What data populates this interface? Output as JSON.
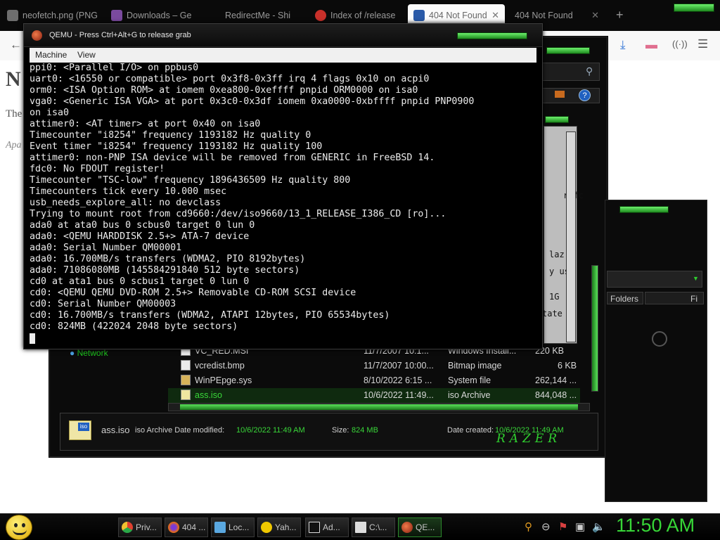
{
  "browser": {
    "tabs": [
      {
        "label": "neofetch.png (PNG I",
        "favicon_color": "#6e6e6e"
      },
      {
        "label": "Downloads – Ge",
        "favicon_color": "#7a4a9e"
      },
      {
        "label": "RedirectMe - Shi",
        "favicon_color": "#3a3a3a"
      },
      {
        "label": "Index of /release",
        "favicon_color": "#c8302a"
      },
      {
        "label": "404 Not Found",
        "favicon_color": "#2a5aa8",
        "active": true
      },
      {
        "label": "404 Not Found",
        "favicon_color": "#000000"
      }
    ],
    "new_tab_icon": "plus-icon",
    "page_fragments": [
      "N",
      "The",
      "Apa"
    ]
  },
  "qemu": {
    "title": "QEMU - Press Ctrl+Alt+G to release grab",
    "menu": [
      "Machine",
      "View"
    ],
    "console_lines": [
      "ppi0: <Parallel I/O> on ppbus0",
      "uart0: <16550 or compatible> port 0x3f8-0x3ff irq 4 flags 0x10 on acpi0",
      "orm0: <ISA Option ROM> at iomem 0xea800-0xeffff pnpid ORM0000 on isa0",
      "vga0: <Generic ISA VGA> at port 0x3c0-0x3df iomem 0xa0000-0xbffff pnpid PNP0900",
      "on isa0",
      "attimer0: <AT timer> at port 0x40 on isa0",
      "Timecounter \"i8254\" frequency 1193182 Hz quality 0",
      "Event timer \"i8254\" frequency 1193182 Hz quality 100",
      "attimer0: non-PNP ISA device will be removed from GENERIC in FreeBSD 14.",
      "fdc0: No FDOUT register!",
      "Timecounter \"TSC-low\" frequency 1896436509 Hz quality 800",
      "Timecounters tick every 10.000 msec",
      "usb_needs_explore_all: no devclass",
      "Trying to mount root from cd9660:/dev/iso9660/13_1_RELEASE_I386_CD [ro]...",
      "ada0 at ata0 bus 0 scbus0 target 0 lun 0",
      "ada0: <QEMU HARDDISK 2.5+> ATA-7 device",
      "ada0: Serial Number QM00001",
      "ada0: 16.700MB/s transfers (WDMA2, PIO 8192bytes)",
      "ada0: 71086080MB (145584291840 512 byte sectors)",
      "cd0 at ata1 bus 0 scbus1 target 0 lun 0",
      "cd0: <QEMU QEMU DVD-ROM 2.5+> Removable CD-ROM SCSI device",
      "cd0: Serial Number QM00003",
      "cd0: 16.700MB/s transfers (WDMA2, ATAPI 12bytes, PIO 65534bytes)",
      "cd0: 824MB (422024 2048 byte sectors)"
    ]
  },
  "explorer": {
    "sidebar_item": "Network",
    "column_folders": "Folders",
    "column_fi": "Fi",
    "partial_right_text": [
      "refc",
      "laz",
      "y us",
      "1G",
      "tate"
    ],
    "files": [
      {
        "name": "VC_RED.MSI",
        "date": "11/7/2007 10:1...",
        "type": "Windows Install...",
        "size": "220 KB"
      },
      {
        "name": "vcredist.bmp",
        "date": "11/7/2007 10:00...",
        "type": "Bitmap image",
        "size": "6 KB"
      },
      {
        "name": "WinPEpge.sys",
        "date": "8/10/2022 6:15 ...",
        "type": "System file",
        "size": "262,144 ..."
      },
      {
        "name": "ass.iso",
        "date": "10/6/2022 11:49...",
        "type": "iso Archive",
        "size": "844,048 ...",
        "selected": true
      }
    ],
    "details": {
      "file_name": "ass.iso",
      "type_modified_label": "iso Archive Date modified:",
      "date_modified": "10/6/2022 11:49 AM",
      "size_label": "Size:",
      "size": "824 MB",
      "created_label": "Date created:",
      "date_created": "10/6/2022 11:49 AM",
      "brand": "RAZER"
    }
  },
  "taskbar": {
    "buttons": [
      {
        "label": "Priv...",
        "icon": "chrome-icon",
        "color": "#e8c33a"
      },
      {
        "label": "404 ...",
        "icon": "firefox-icon",
        "color": "#e06a1e"
      },
      {
        "label": "Loc...",
        "icon": "local-disk-icon",
        "color": "#5aa8e0"
      },
      {
        "label": "Yah...",
        "icon": "yahoo-messenger-icon",
        "color": "#f0c800"
      },
      {
        "label": "Ad...",
        "icon": "command-prompt-icon",
        "color": "#dddddd"
      },
      {
        "label": "C:\\...",
        "icon": "7zip-icon",
        "color": "#dddddd"
      },
      {
        "label": "QE...",
        "icon": "qemu-icon",
        "color": "#d84a2a",
        "active": true
      }
    ],
    "clock": "11:50 AM"
  }
}
